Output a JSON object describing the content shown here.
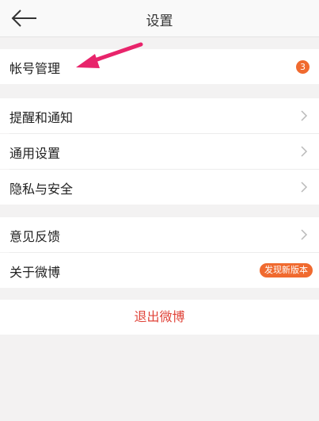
{
  "header": {
    "title": "设置"
  },
  "sections": {
    "account": {
      "label": "帐号管理",
      "badge": "3"
    },
    "group2": [
      {
        "label": "提醒和通知"
      },
      {
        "label": "通用设置"
      },
      {
        "label": "隐私与安全"
      }
    ],
    "group3": [
      {
        "label": "意见反馈"
      },
      {
        "label": "关于微博",
        "badge": "发现新版本"
      }
    ]
  },
  "logout": {
    "label": "退出微博"
  },
  "colors": {
    "accent": "#f06a2f",
    "logout": "#e0443a",
    "annotation_arrow": "#e8246b"
  },
  "icons": {
    "back": "arrow-left-icon",
    "chevron": "chevron-right-icon",
    "annotation": "pink-arrow-icon"
  }
}
